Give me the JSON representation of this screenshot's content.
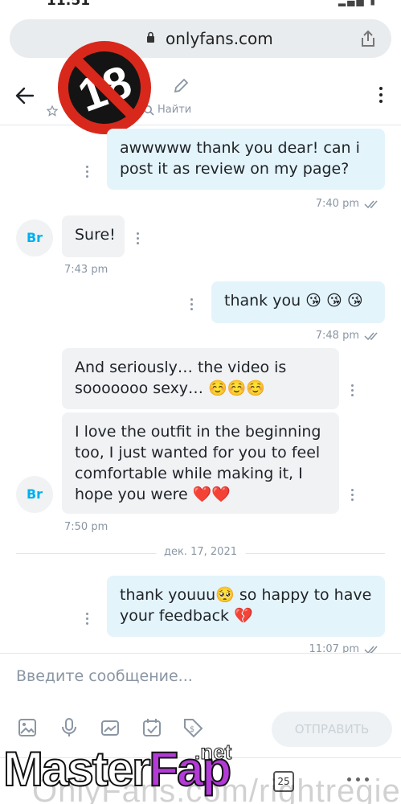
{
  "browser": {
    "url": "onlyfans.com",
    "tab_count": "25"
  },
  "header": {
    "search_label": "Найти"
  },
  "overlay": {
    "badge_text": "18"
  },
  "messages": [
    {
      "id": "m1",
      "direction": "out",
      "text": "awwwww thank you dear! can i post it as review on my page?",
      "time": "7:40 pm"
    },
    {
      "id": "m2",
      "direction": "in",
      "avatar": "Br",
      "text": "Sure!",
      "time": "7:43 pm"
    },
    {
      "id": "m3",
      "direction": "out",
      "text": "thank you 😘 😘 😘",
      "time": "7:48 pm"
    },
    {
      "id": "m4",
      "direction": "in",
      "text": "And seriously… the video is sooooooo sexy… ☺️☺️☺️"
    },
    {
      "id": "m5",
      "direction": "in",
      "avatar": "Br",
      "text": "I love the outfit in the beginning too, I just wanted for you to feel comfortable while making it, I hope you were ❤️❤️",
      "time": "7:50 pm"
    },
    {
      "id": "m6",
      "direction": "out",
      "text": "thank youuu🥺 so happy to have your feedback 💔",
      "time": "11:07 pm"
    }
  ],
  "date_separator": "дек. 17, 2021",
  "composer": {
    "placeholder": "Введите сообщение...",
    "send_label": "ОТПРАВИТЬ"
  },
  "watermark": {
    "logo_left": "Master",
    "logo_right": "Fap",
    "logo_suffix": ".net",
    "bottom_text": "OnlyFans.com/rightregie"
  },
  "colors": {
    "accent": "#00aff0",
    "outgoing_bubble": "#e4f4fb",
    "incoming_bubble": "#f0f2f4",
    "meta_text": "#8a96a3"
  }
}
